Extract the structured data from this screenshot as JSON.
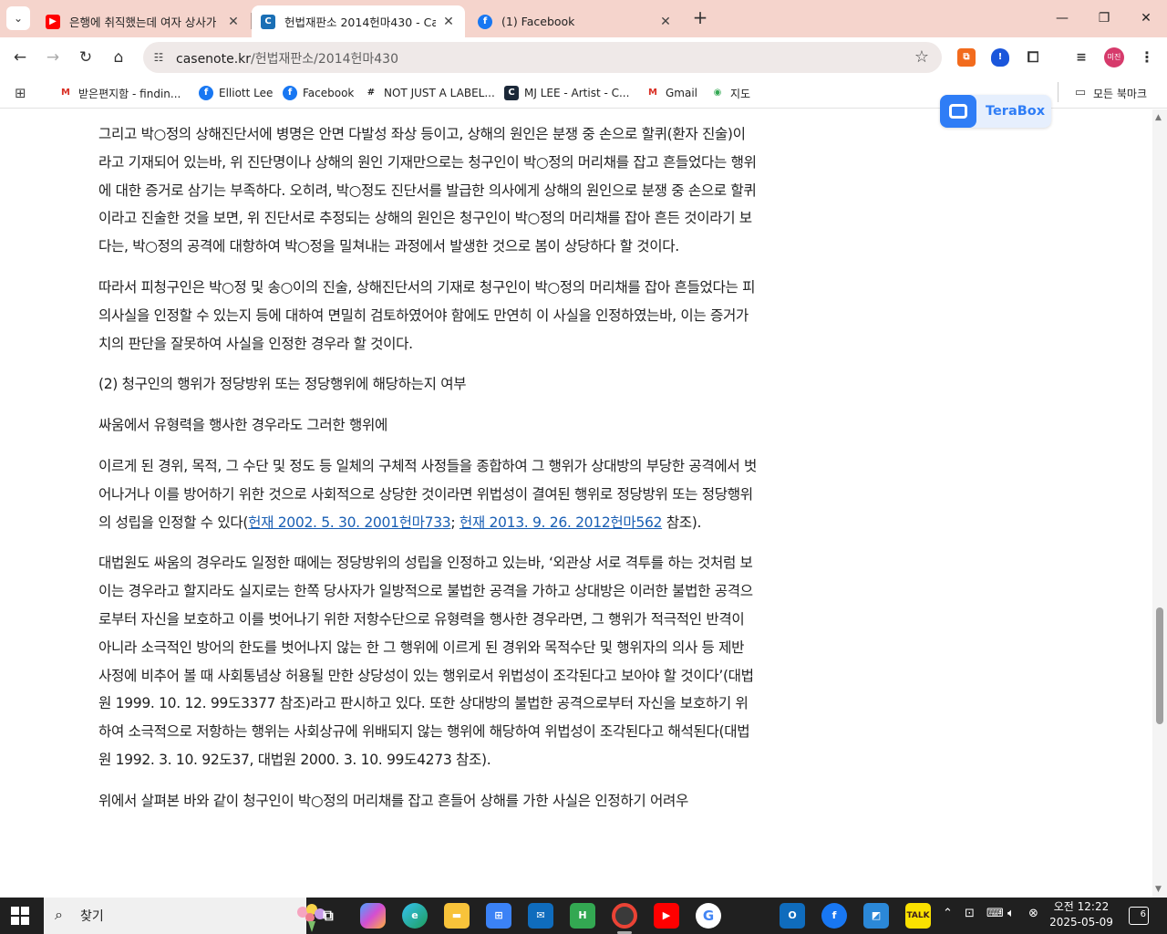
{
  "browser": {
    "tabs": [
      {
        "title": "은행에 취직했는데 여자 상사가",
        "favicon": "youtube-icon",
        "active": false
      },
      {
        "title": "헌법재판소 2014헌마430 - Ca",
        "favicon": "casenote-icon",
        "active": true
      },
      {
        "title": "(1) Facebook",
        "favicon": "facebook-icon",
        "active": false
      }
    ],
    "url_domain": "casenote.kr",
    "url_path": "/헌법재판소/2014헌마430",
    "profile_label": "미진"
  },
  "bookmarks": [
    {
      "label": "받은편지함 - findin...",
      "icon": "gmail-icon"
    },
    {
      "label": "Elliott Lee",
      "icon": "facebook-icon"
    },
    {
      "label": "Facebook",
      "icon": "facebook-icon"
    },
    {
      "label": "NOT JUST A LABEL...",
      "icon": "njal-icon"
    },
    {
      "label": "MJ LEE - Artist - C...",
      "icon": "artist-icon"
    },
    {
      "label": "Gmail",
      "icon": "gmail-icon"
    },
    {
      "label": "지도",
      "icon": "maps-icon"
    }
  ],
  "all_bookmarks": "모든 북마크",
  "terabox": {
    "label": "TeraBox"
  },
  "article": {
    "p1": "그리고 박○정의 상해진단서에 병명은 안면 다발성 좌상 등이고, 상해의 원인은 분쟁 중 손으로 할퀴(환자 진술)이라고 기재되어 있는바, 위 진단명이나 상해의 원인 기재만으로는 청구인이 박○정의 머리채를 잡고 흔들었다는 행위에 대한 증거로 삼기는 부족하다. 오히려, 박○정도 진단서를 발급한 의사에게 상해의 원인으로 분쟁 중 손으로 할퀴이라고 진술한 것을 보면, 위 진단서로 추정되는 상해의 원인은 청구인이 박○정의 머리채를 잡아 흔든 것이라기 보다는, 박○정의 공격에 대항하여 박○정을 밀쳐내는 과정에서 발생한 것으로 봄이 상당하다 할 것이다.",
    "p2": "따라서 피청구인은 박○정 및 송○이의 진술, 상해진단서의 기재로 청구인이 박○정의 머리채를 잡아 흔들었다는 피의사실을 인정할 수 있는지 등에 대하여 면밀히 검토하였어야 함에도 만연히 이 사실을 인정하였는바, 이는 증거가치의 판단을 잘못하여 사실을 인정한 경우라 할 것이다.",
    "p3": "(2) 청구인의 행위가 정당방위 또는 정당행위에 해당하는지 여부",
    "p4": "싸움에서 유형력을 행사한 경우라도 그러한 행위에",
    "p5_a": "이르게 된 경위, 목적, 그 수단 및 정도 등 일체의 구체적 사정들을 종합하여 그 행위가 상대방의 부당한 공격에서 벗어나거나 이를 방어하기 위한 것으로 사회적으로 상당한 것이라면 위법성이 결여된 행위로 정당방위 또는 정당행위의 성립을 인정할 수 있다(",
    "p5_link1": "헌재 2002. 5. 30. 2001헌마733",
    "p5_sep": "; ",
    "p5_link2": "헌재 2013. 9. 26. 2012헌마562",
    "p5_b": " 참조).",
    "p6": "대법원도 싸움의 경우라도 일정한 때에는 정당방위의 성립을 인정하고 있는바, ‘외관상 서로 격투를 하는 것처럼 보이는 경우라고 할지라도 실지로는 한쪽 당사자가 일방적으로 불법한 공격을 가하고 상대방은 이러한 불법한 공격으로부터 자신을 보호하고 이를 벗어나기 위한 저항수단으로 유형력을 행사한 경우라면, 그 행위가 적극적인 반격이 아니라 소극적인 방어의 한도를 벗어나지 않는 한 그 행위에 이르게 된 경위와 목적수단 및 행위자의 의사 등 제반사정에 비추어 볼 때 사회통념상 허용될 만한 상당성이 있는 행위로서 위법성이 조각된다고 보아야 할 것이다’(대법원 1999. 10. 12. 99도3377 참조)라고 판시하고 있다. 또한 상대방의 불법한 공격으로부터 자신을 보호하기 위하여 소극적으로 저항하는 행위는 사회상규에 위배되지 않는 행위에 해당하여 위법성이 조각된다고 해석된다(대법원 1992. 3. 10. 92도37, 대법원 2000. 3. 10. 99도4273 참조).",
    "p7": "위에서 살펴본 바와 같이 청구인이 박○정의 머리채를 잡고 흔들어 상해를 가한 사실은 인정하기 어려우"
  },
  "taskbar": {
    "search_label": "찾기",
    "time": "오전 12:22",
    "date": "2025-05-09",
    "notification_count": "6",
    "apps": [
      "task-view-icon",
      "copilot-icon",
      "edge-icon",
      "file-explorer-icon",
      "store-icon",
      "mail-icon",
      "hangul-icon",
      "chrome-icon",
      "youtube-icon",
      "google-icon",
      "outlook-icon",
      "facebook-icon",
      "paint-icon",
      "kakaotalk-icon"
    ]
  },
  "colors": {
    "tabstrip": "#f5d4cc",
    "link": "#1a5fb4",
    "terabox_blue": "#2f7df6",
    "taskbar": "#202020"
  }
}
